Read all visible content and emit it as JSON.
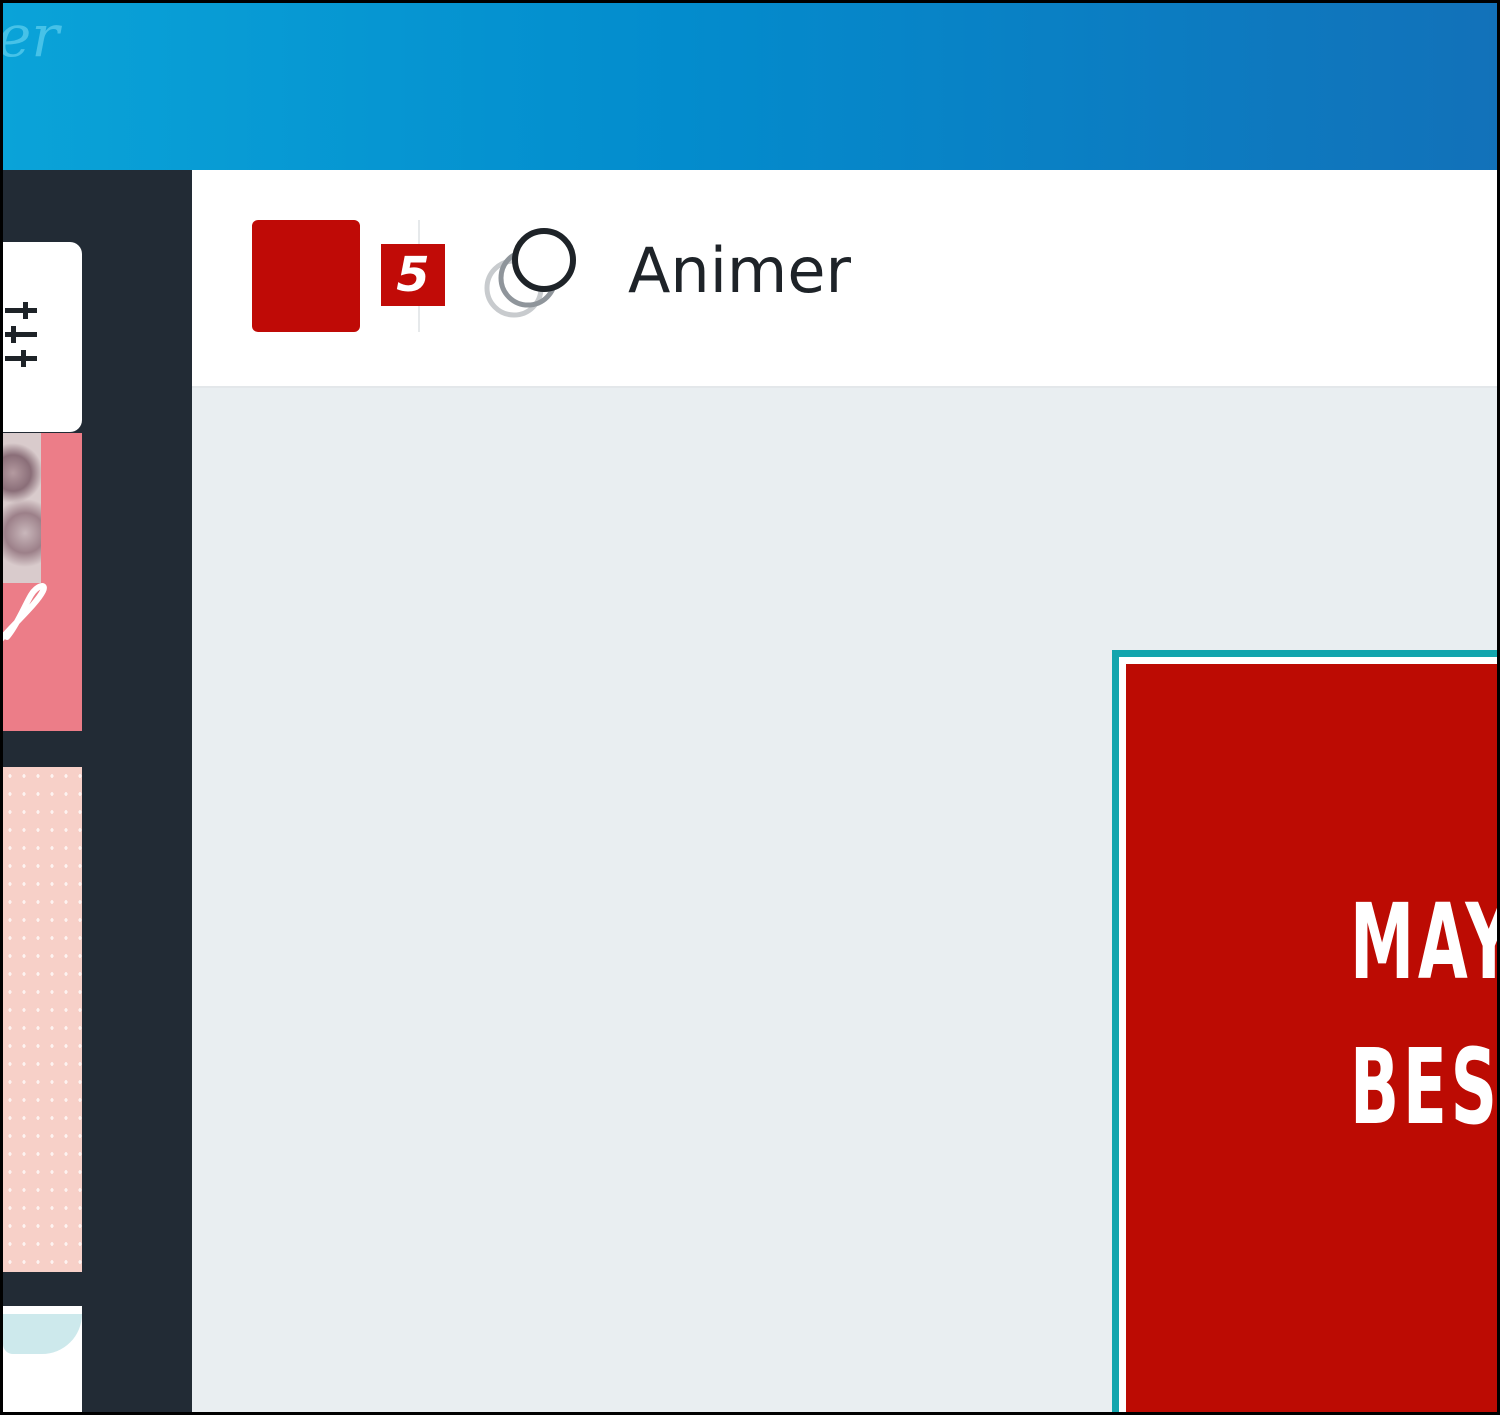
{
  "header": {
    "brand_fragment": "er"
  },
  "toolbar": {
    "color_swatch": "#bf0a06",
    "badge_count": "5",
    "animate_icon": "circles-animation-icon",
    "animate_label": "Animer"
  },
  "sidebar": {
    "filter_icon": "sliders-filter-icon",
    "thumbnails": [
      {
        "name": "pink-photo-template",
        "color": "#ec7d88"
      },
      {
        "name": "blush-dotted-template",
        "color": "#f7d0c8"
      },
      {
        "name": "mint-template",
        "color": "#cde9ec"
      }
    ]
  },
  "canvas": {
    "frame_color": "#13a5ad",
    "page_color": "#bc0b03",
    "text_line_1": "MAY",
    "text_line_2": "BES"
  }
}
